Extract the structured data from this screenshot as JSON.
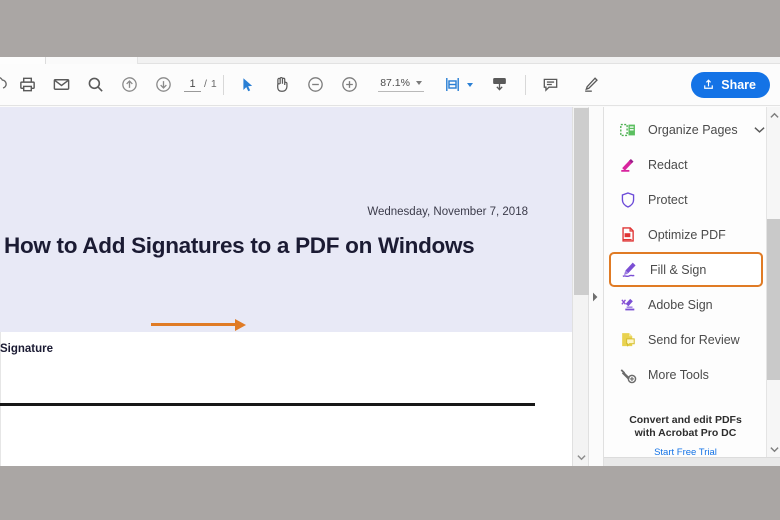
{
  "toolbar": {
    "icons": [
      {
        "name": "save-cloud-icon",
        "label": "Save"
      },
      {
        "name": "print-icon",
        "label": "Print"
      },
      {
        "name": "email-icon",
        "label": "Email"
      },
      {
        "name": "search-icon",
        "label": "Find"
      },
      {
        "name": "previous-page-icon",
        "label": "Previous Page"
      },
      {
        "name": "next-page-icon",
        "label": "Next Page"
      }
    ],
    "page_current": "1",
    "page_total": "/ 1",
    "select_tool_label": "Select Tool",
    "hand_tool_label": "Hand Tool",
    "zoom_out_label": "Zoom Out",
    "zoom_in_label": "Zoom In",
    "zoom_value": "87.1%",
    "fit_page_label": "Fit Page",
    "download_label": "Download",
    "comment_label": "Add Comment",
    "highlight_label": "Highlight Text",
    "share_label": "Share"
  },
  "document": {
    "date": "Wednesday, November 7, 2018",
    "title": "How to Add Signatures to a PDF on Windows",
    "signature_label": "Signature"
  },
  "sidebar": {
    "items": [
      {
        "label": "Organize Pages",
        "icon": "organize-pages-icon",
        "chevron": true,
        "selected": false
      },
      {
        "label": "Redact",
        "icon": "redact-icon",
        "chevron": false,
        "selected": false
      },
      {
        "label": "Protect",
        "icon": "protect-shield-icon",
        "chevron": false,
        "selected": false
      },
      {
        "label": "Optimize PDF",
        "icon": "optimize-pdf-icon",
        "chevron": false,
        "selected": false
      },
      {
        "label": "Fill & Sign",
        "icon": "fill-and-sign-icon",
        "chevron": false,
        "selected": true
      },
      {
        "label": "Adobe Sign",
        "icon": "adobe-sign-icon",
        "chevron": false,
        "selected": false
      },
      {
        "label": "Send for Review",
        "icon": "send-for-review-icon",
        "chevron": false,
        "selected": false
      },
      {
        "label": "More Tools",
        "icon": "more-tools-wrench-icon",
        "chevron": false,
        "selected": false
      }
    ],
    "promo_line1": "Convert and edit PDFs",
    "promo_line2": "with Acrobat Pro DC",
    "promo_cta": "Start Free Trial"
  },
  "colors": {
    "accent_blue": "#1473e6",
    "annotation_orange": "#e07b25",
    "doc_header_band": "#e8e9f6",
    "desktop_gray": "#aaa6a4"
  }
}
